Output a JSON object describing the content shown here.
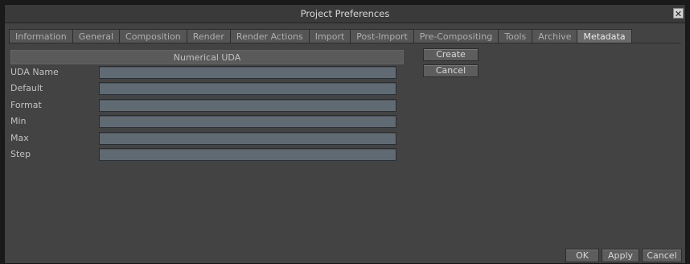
{
  "window": {
    "title": "Project Preferences",
    "close_glyph": "✕"
  },
  "tabs": [
    {
      "label": "Information",
      "active": false
    },
    {
      "label": "General",
      "active": false
    },
    {
      "label": "Composition",
      "active": false
    },
    {
      "label": "Render",
      "active": false
    },
    {
      "label": "Render Actions",
      "active": false
    },
    {
      "label": "Import",
      "active": false
    },
    {
      "label": "Post-Import",
      "active": false
    },
    {
      "label": "Pre-Compositing",
      "active": false
    },
    {
      "label": "Tools",
      "active": false
    },
    {
      "label": "Archive",
      "active": false
    },
    {
      "label": "Metadata",
      "active": true
    }
  ],
  "section": {
    "title": "Numerical UDA"
  },
  "fields": [
    {
      "label": "UDA Name",
      "value": ""
    },
    {
      "label": "Default",
      "value": ""
    },
    {
      "label": "Format",
      "value": ""
    },
    {
      "label": "Min",
      "value": ""
    },
    {
      "label": "Max",
      "value": ""
    },
    {
      "label": "Step",
      "value": ""
    }
  ],
  "actions": {
    "create_label": "Create",
    "cancel_label": "Cancel"
  },
  "footer": {
    "ok_label": "OK",
    "apply_label": "Apply",
    "cancel_label": "Cancel"
  }
}
